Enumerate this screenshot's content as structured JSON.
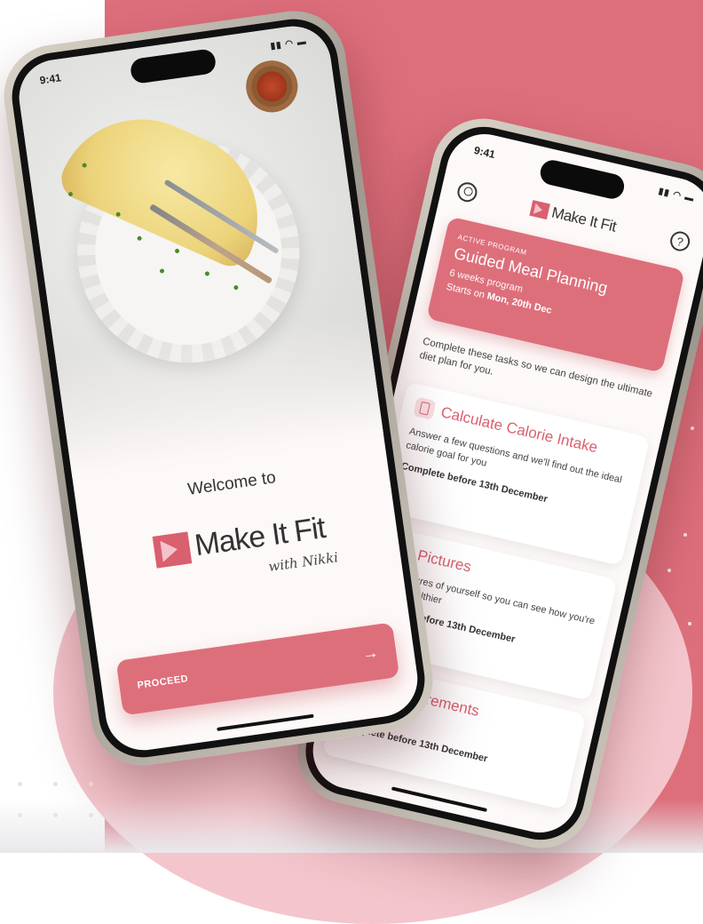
{
  "brand": {
    "name": "Make It Fit",
    "byline": "with Nikki",
    "accent_color": "#dd6f7b",
    "soft_accent": "#f4c5cc"
  },
  "welcome_screen": {
    "time": "9:41",
    "welcome_text": "Welcome to",
    "proceed_label": "PROCEED",
    "proceed_icon": "arrow-right-icon"
  },
  "dashboard_screen": {
    "time": "9:41",
    "header_icons": [
      "profile-icon",
      "help-icon"
    ],
    "help_glyph": "?",
    "active_program": {
      "tag": "ACTIVE PROGRAM",
      "title": "Guided Meal Planning",
      "duration": "6 weeks program",
      "starts_prefix": "Starts on ",
      "starts_date": "Mon, 20th Dec"
    },
    "intro": "Complete these tasks so we can design the ultimate diet plan for you.",
    "tasks": [
      {
        "title": "Calculate Calorie Intake",
        "icon": "calculator-icon",
        "description": "Answer a few questions and we'll find out the ideal calorie goal for you",
        "due": "Complete before 13th December"
      },
      {
        "title": "Take Pictures",
        "description": "Take pictures of yourself so you can see how you're getting healthier",
        "due": "Complete before 13th December"
      },
      {
        "title": "Add Measurements",
        "due": "Complete before 13th December"
      }
    ]
  }
}
